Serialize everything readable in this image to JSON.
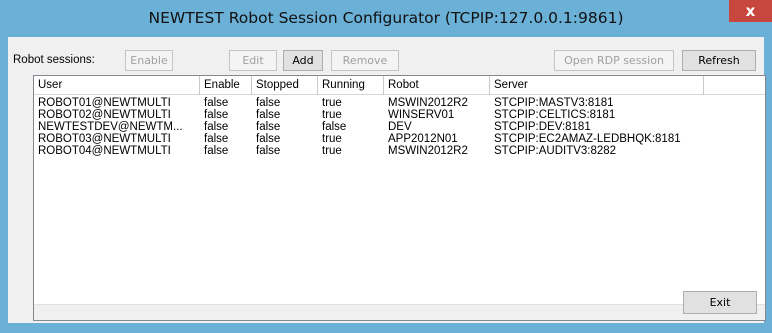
{
  "window": {
    "title": "NEWTEST Robot Session Configurator (TCPIP:127.0.0.1:9861)",
    "close_glyph": "x"
  },
  "toolbar": {
    "sessions_label": "Robot sessions:",
    "enable_label": "Enable",
    "edit_label": "Edit",
    "add_label": "Add",
    "remove_label": "Remove",
    "rdp_label": "Open RDP session",
    "refresh_label": "Refresh"
  },
  "table": {
    "columns": [
      "User",
      "Enable",
      "Stopped",
      "Running",
      "Robot",
      "Server"
    ],
    "rows": [
      [
        "ROBOT01@NEWTMULTI",
        "false",
        "false",
        "true",
        "MSWIN2012R2",
        "STCPIP:MASTV3:8181"
      ],
      [
        "ROBOT02@NEWTMULTI",
        "false",
        "false",
        "true",
        "WINSERV01",
        "STCPIP:CELTICS:8181"
      ],
      [
        "NEWTESTDEV@NEWTM...",
        "false",
        "false",
        "false",
        "DEV",
        "STCPIP:DEV:8181"
      ],
      [
        "ROBOT03@NEWTMULTI",
        "false",
        "false",
        "true",
        "APP2012N01",
        "STCPIP:EC2AMAZ-LEDBHQK:8181"
      ],
      [
        "ROBOT04@NEWTMULTI",
        "false",
        "false",
        "true",
        "MSWIN2012R2",
        "STCPIP:AUDITV3:8282"
      ]
    ]
  },
  "footer": {
    "exit_label": "Exit"
  },
  "colors": {
    "titlebar": "#6bb0d6",
    "close": "#c7463d",
    "client": "#f0f0f0"
  }
}
